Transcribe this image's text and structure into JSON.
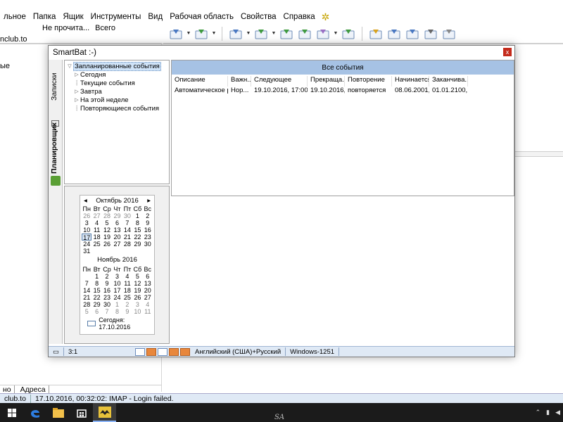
{
  "background_app": {
    "menu": [
      "льное",
      "Папка",
      "Ящик",
      "Инструменты",
      "Вид",
      "Рабочая область",
      "Свойства",
      "Справка"
    ],
    "menu_extra_icon": "bat-icon",
    "account_suffix": "nclub.to",
    "columns": [
      "Не прочита...",
      "Всего"
    ],
    "left_pane_label": "ые",
    "bottom_tabs": [
      "но",
      "Адреса"
    ],
    "status_account": "club.to",
    "status_message": "17.10.2016, 00:32:02: IMAP  - Login failed."
  },
  "toolbar_icons": [
    "new-mail-icon",
    "get-mail-icon",
    "compose-icon",
    "download-icon",
    "receive-icon",
    "forward-back-icon",
    "send-icon",
    "print-receive-icon",
    "address-book-icon",
    "search-icon",
    "save-icon",
    "print-icon",
    "trash-icon"
  ],
  "dialog": {
    "title": "SmartBat :-)",
    "close_label": "x",
    "side_tabs": [
      "Записки",
      "Планировщик"
    ],
    "tree": [
      {
        "label": "Запланированные события",
        "arrow": "▽",
        "indent": 0,
        "selected": true
      },
      {
        "label": "Сегодня",
        "arrow": "▷",
        "indent": 1
      },
      {
        "label": "Текущие события",
        "arrow": "",
        "indent": 1
      },
      {
        "label": "Завтра",
        "arrow": "▷",
        "indent": 1
      },
      {
        "label": "На этой неделе",
        "arrow": "▷",
        "indent": 1
      },
      {
        "label": "Повторяющиеся события",
        "arrow": "",
        "indent": 1
      }
    ],
    "calendar": {
      "prev": "◂",
      "next": "▸",
      "month1": "Октябрь 2016",
      "month2": "Ноябрь 2016",
      "weekdays": [
        "Пн",
        "Вт",
        "Ср",
        "Чт",
        "Пт",
        "Сб",
        "Вс"
      ],
      "month1_days": [
        {
          "d": "26",
          "dim": true
        },
        {
          "d": "27",
          "dim": true
        },
        {
          "d": "28",
          "dim": true
        },
        {
          "d": "29",
          "dim": true
        },
        {
          "d": "30",
          "dim": true
        },
        {
          "d": "1"
        },
        {
          "d": "2"
        },
        {
          "d": "3"
        },
        {
          "d": "4"
        },
        {
          "d": "5"
        },
        {
          "d": "6"
        },
        {
          "d": "7"
        },
        {
          "d": "8"
        },
        {
          "d": "9"
        },
        {
          "d": "10"
        },
        {
          "d": "11"
        },
        {
          "d": "12"
        },
        {
          "d": "13"
        },
        {
          "d": "14"
        },
        {
          "d": "15"
        },
        {
          "d": "16"
        },
        {
          "d": "17",
          "today": true
        },
        {
          "d": "18"
        },
        {
          "d": "19"
        },
        {
          "d": "20"
        },
        {
          "d": "21"
        },
        {
          "d": "22"
        },
        {
          "d": "23"
        },
        {
          "d": "24"
        },
        {
          "d": "25"
        },
        {
          "d": "26"
        },
        {
          "d": "27"
        },
        {
          "d": "28"
        },
        {
          "d": "29"
        },
        {
          "d": "30"
        },
        {
          "d": "31"
        },
        {
          "d": ""
        },
        {
          "d": ""
        },
        {
          "d": ""
        },
        {
          "d": ""
        },
        {
          "d": ""
        },
        {
          "d": ""
        }
      ],
      "month2_days": [
        {
          "d": ""
        },
        {
          "d": "1"
        },
        {
          "d": "2"
        },
        {
          "d": "3"
        },
        {
          "d": "4"
        },
        {
          "d": "5"
        },
        {
          "d": "6"
        },
        {
          "d": "7"
        },
        {
          "d": "8"
        },
        {
          "d": "9"
        },
        {
          "d": "10"
        },
        {
          "d": "11"
        },
        {
          "d": "12"
        },
        {
          "d": "13"
        },
        {
          "d": "14"
        },
        {
          "d": "15"
        },
        {
          "d": "16"
        },
        {
          "d": "17"
        },
        {
          "d": "18"
        },
        {
          "d": "19"
        },
        {
          "d": "20"
        },
        {
          "d": "21"
        },
        {
          "d": "22"
        },
        {
          "d": "23"
        },
        {
          "d": "24"
        },
        {
          "d": "25"
        },
        {
          "d": "26"
        },
        {
          "d": "27"
        },
        {
          "d": "28"
        },
        {
          "d": "29"
        },
        {
          "d": "30"
        },
        {
          "d": "1",
          "dim": true
        },
        {
          "d": "2",
          "dim": true
        },
        {
          "d": "3",
          "dim": true
        },
        {
          "d": "4",
          "dim": true
        },
        {
          "d": "5",
          "dim": true
        },
        {
          "d": "6",
          "dim": true
        },
        {
          "d": "7",
          "dim": true
        },
        {
          "d": "8",
          "dim": true
        },
        {
          "d": "9",
          "dim": true
        },
        {
          "d": "10",
          "dim": true
        },
        {
          "d": "11",
          "dim": true
        }
      ],
      "today_label": "Сегодня: 17.10.2016"
    },
    "events": {
      "header": "Все события",
      "columns": [
        "Описание",
        "Важн...",
        "Следующее",
        "Прекраща...",
        "Повторение",
        "Начинается",
        "Заканчива..."
      ],
      "rows": [
        [
          "Автоматическое р...",
          "Нор...",
          "19.10.2016, 17:00:0...",
          "19.10.2016,...",
          "повторяется",
          "08.06.2001,...",
          "01.01.2100,..."
        ]
      ]
    },
    "status": {
      "position": "3:1",
      "language": "Английский (США)+Русский",
      "encoding": "Windows-1251"
    }
  },
  "taskbar": {
    "center_text": "SA",
    "icons": [
      "windows-start-icon",
      "edge-icon",
      "explorer-icon",
      "store-icon",
      "thebat-icon"
    ]
  }
}
